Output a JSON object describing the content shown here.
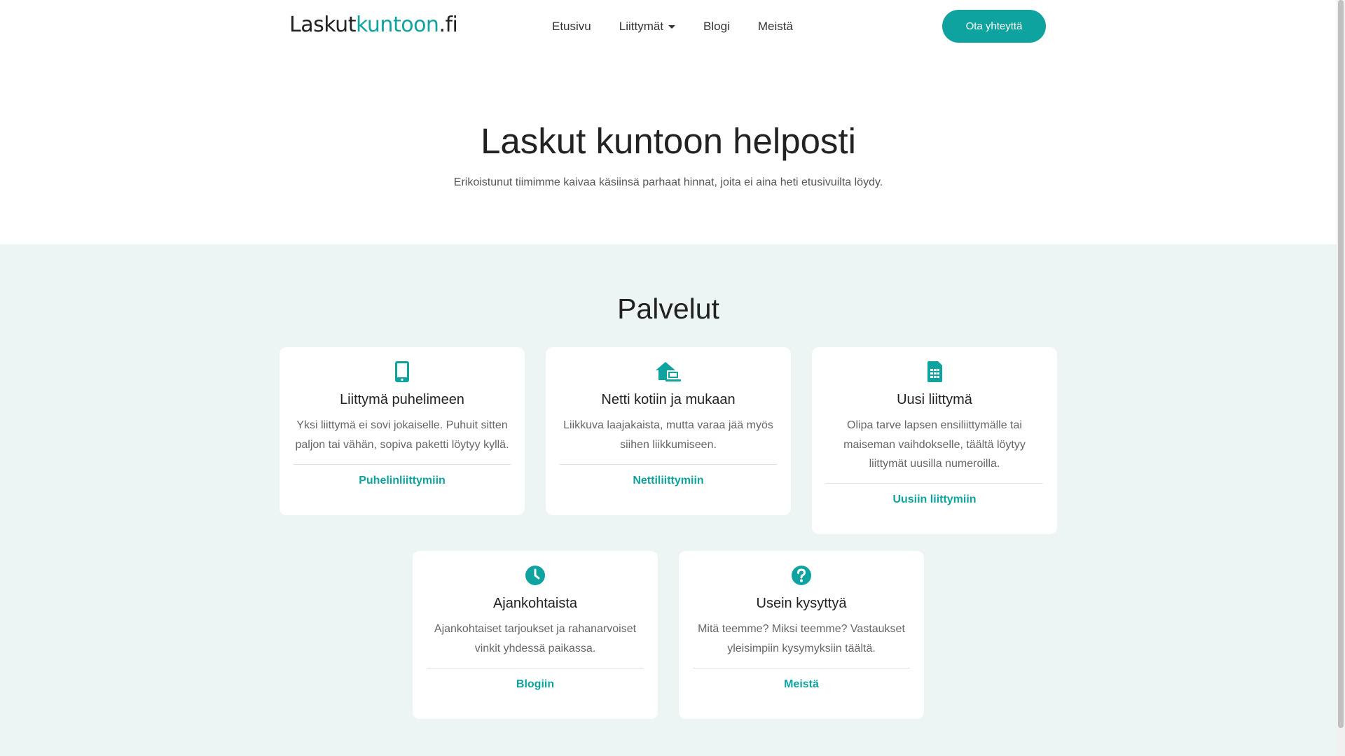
{
  "header": {
    "logo_part1": "Laskut",
    "logo_part2": "kuntoon",
    "logo_part3": ".fi",
    "nav": [
      {
        "label": "Etusivu"
      },
      {
        "label": "Liittymät",
        "dropdown": true
      },
      {
        "label": "Blogi"
      },
      {
        "label": "Meistä"
      }
    ],
    "cta_label": "Ota yhteyttä"
  },
  "hero": {
    "title": "Laskut kuntoon helposti",
    "subtitle": "Erikoistunut tiimimme kaivaa käsiinsä parhaat hinnat, joita ei aina heti etusivuilta löydy."
  },
  "services": {
    "heading": "Palvelut",
    "cards": [
      {
        "icon": "mobile-phone-icon",
        "title": "Liittymä puhelimeen",
        "description": "Yksi liittymä ei sovi jokaiselle. Puhuit sitten paljon tai vähän, sopiva paketti löytyy kyllä.",
        "link": "Puhelinliittymiin"
      },
      {
        "icon": "home-laptop-icon",
        "title": "Netti kotiin ja mukaan",
        "description": "Liikkuva laajakaista, mutta varaa jää myös siihen liikkumiseen.",
        "link": "Nettiliittymiin"
      },
      {
        "icon": "sim-card-icon",
        "title": "Uusi liittymä",
        "description": "Olipa tarve lapsen ensiliittymälle tai maiseman vaihdokselle, täältä löytyy liittymät uusilla numeroilla.",
        "link": "Uusiin liittymiin"
      },
      {
        "icon": "clock-icon",
        "title": "Ajankohtaista",
        "description": "Ajankohtaiset tarjoukset ja rahanarvoiset vinkit yhdessä paikassa.",
        "link": "Blogiin"
      },
      {
        "icon": "question-circle-icon",
        "title": "Usein kysyttyä",
        "description": "Mitä teemme? Miksi teemme? Vastaukset yleisimpiin kysymyksiin täältä.",
        "link": "Meistä"
      }
    ]
  },
  "colors": {
    "accent": "#0fa3a0",
    "section_bg": "#edf5f4"
  }
}
